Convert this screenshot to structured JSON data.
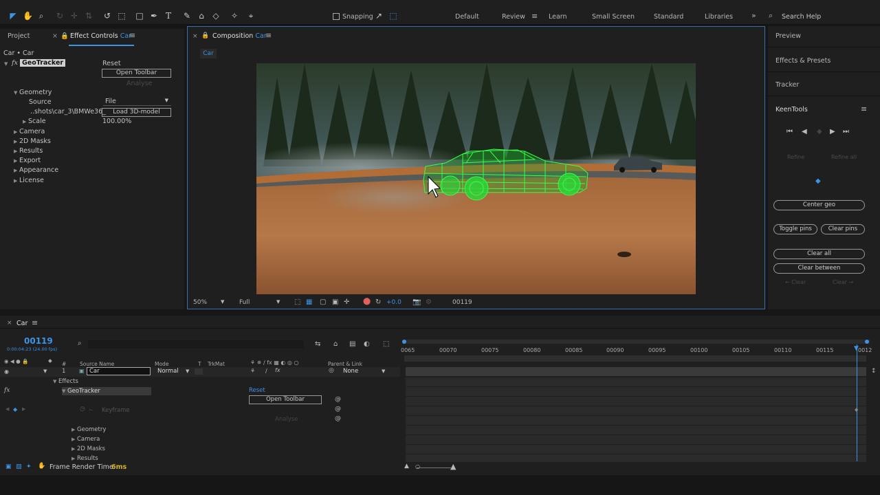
{
  "toolbar": {
    "snapping": "Snapping",
    "workspaces": [
      "Default",
      "Review",
      "Learn",
      "Small Screen",
      "Standard",
      "Libraries"
    ],
    "active_workspace": "Review",
    "search_placeholder": "Search Help"
  },
  "left_panel": {
    "tab_project": "Project",
    "tab_effect_controls": "Effect Controls",
    "tab_effect_controls_layer": "Car",
    "breadcrumb": "Car • Car",
    "effect_name": "GeoTracker",
    "reset": "Reset",
    "open_toolbar": "Open Toolbar",
    "analyse": "Analyse",
    "geometry": "Geometry",
    "source_label": "Source",
    "source_value": "File",
    "file_path": "..shots\\car_3\\BMWe36_",
    "load_model": "Load 3D-model",
    "scale_label": "Scale",
    "scale_value": "100.00%",
    "sections": [
      "Camera",
      "2D Masks",
      "Results",
      "Export",
      "Appearance",
      "License"
    ]
  },
  "composition": {
    "tab_label": "Composition",
    "tab_name": "Car",
    "subtab": "Car",
    "zoom": "50%",
    "resolution": "Full",
    "exposure": "+0.0",
    "timecode": "00119"
  },
  "right_panel": {
    "preview": "Preview",
    "effects_presets": "Effects & Presets",
    "tracker": "Tracker",
    "keentools": "KeenTools",
    "refine": "Refine",
    "refine_all": "Refine all",
    "center_geo": "Center geo",
    "toggle_pins": "Toggle pins",
    "clear_pins": "Clear pins",
    "clear_all": "Clear all",
    "clear_between": "Clear between",
    "clear_left": "← Clear",
    "clear_right": "Clear →"
  },
  "timeline": {
    "comp_name": "Car",
    "current_frame": "00119",
    "fps_info": "0:00:04:23 (24.00 fps)",
    "headers": {
      "source_name": "Source Name",
      "mode": "Mode",
      "t": "T",
      "trkmat": "TrkMat",
      "parent": "Parent & Link"
    },
    "layer_number": "1",
    "layer_name": "Car",
    "layer_mode": "Normal",
    "parent_value": "None",
    "effects_label": "Effects",
    "effect_name": "GeoTracker",
    "reset": "Reset",
    "open_toolbar": "Open Toolbar",
    "keyframe": "Keyframe",
    "analyse": "Analyse",
    "sub_sections": [
      "Geometry",
      "Camera",
      "2D Masks",
      "Results"
    ],
    "ruler_ticks": [
      "0065",
      "00070",
      "00075",
      "00080",
      "00085",
      "00090",
      "00095",
      "00100",
      "00105",
      "00110",
      "00115",
      "0012"
    ]
  },
  "status": {
    "render_label": "Frame Render Time:",
    "render_value": "6ms"
  },
  "colors": {
    "accent": "#3d94e6",
    "wireframe": "#39ff4a",
    "panel": "#1f1f1f",
    "background": "#161616"
  }
}
